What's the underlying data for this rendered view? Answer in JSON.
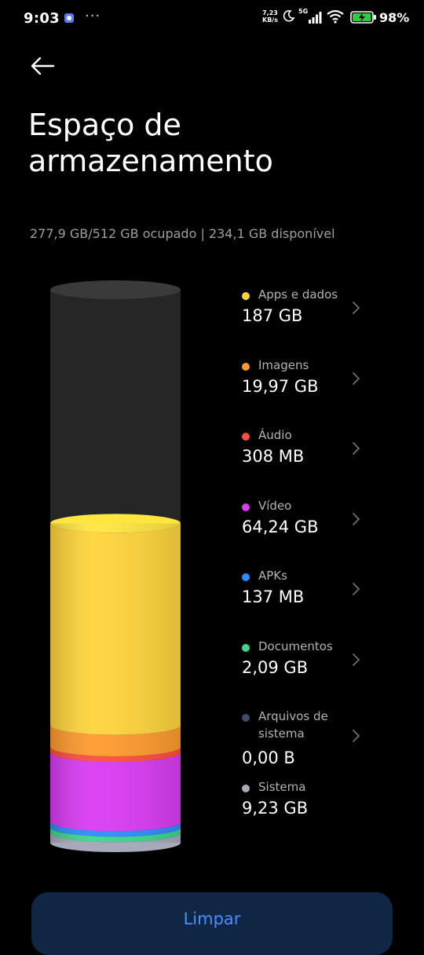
{
  "status_bar": {
    "time": "9:03",
    "net_speed_value": "7,23",
    "net_speed_unit": "KB/s",
    "network_type": "5G",
    "battery_percent": "98%",
    "battery_level": 0.98
  },
  "header": {
    "title": "Espaço de armazenamento",
    "summary": "277,9 GB/512 GB ocupado | 234,1 GB disponível"
  },
  "storage": {
    "total_gb": 512,
    "used_gb": 277.9,
    "categories": [
      {
        "label": "Apps e dados",
        "value": "187 GB",
        "gb": 187,
        "color": "#FFD43B",
        "icon": "yellow-dot",
        "has_chevron": true
      },
      {
        "label": "Imagens",
        "value": "19,97 GB",
        "gb": 19.97,
        "color": "#FF9A2E",
        "icon": "orange-dot",
        "has_chevron": true
      },
      {
        "label": "Áudio",
        "value": "308 MB",
        "gb": 0.308,
        "color": "#FF4D3F",
        "icon": "red-dot",
        "has_chevron": true
      },
      {
        "label": "Vídeo",
        "value": "64,24 GB",
        "gb": 64.24,
        "color": "#D93BF3",
        "icon": "magenta-dot",
        "has_chevron": true
      },
      {
        "label": "APKs",
        "value": "137 MB",
        "gb": 0.137,
        "color": "#2F8BFF",
        "icon": "blue-dot",
        "has_chevron": true
      },
      {
        "label": "Documentos",
        "value": "2,09 GB",
        "gb": 2.09,
        "color": "#3DD68C",
        "icon": "green-dot",
        "has_chevron": true
      },
      {
        "label": "Arquivos de sistema",
        "value": "0,00 B",
        "gb": 0,
        "color": "#3F4B6B",
        "icon": "slate-dot",
        "has_chevron": true
      },
      {
        "label": "Sistema",
        "value": "9,23 GB",
        "gb": 9.23,
        "color": "#A7AABB",
        "icon": "gray-dot",
        "has_chevron": false
      }
    ]
  },
  "actions": {
    "clean_label": "Limpar"
  }
}
